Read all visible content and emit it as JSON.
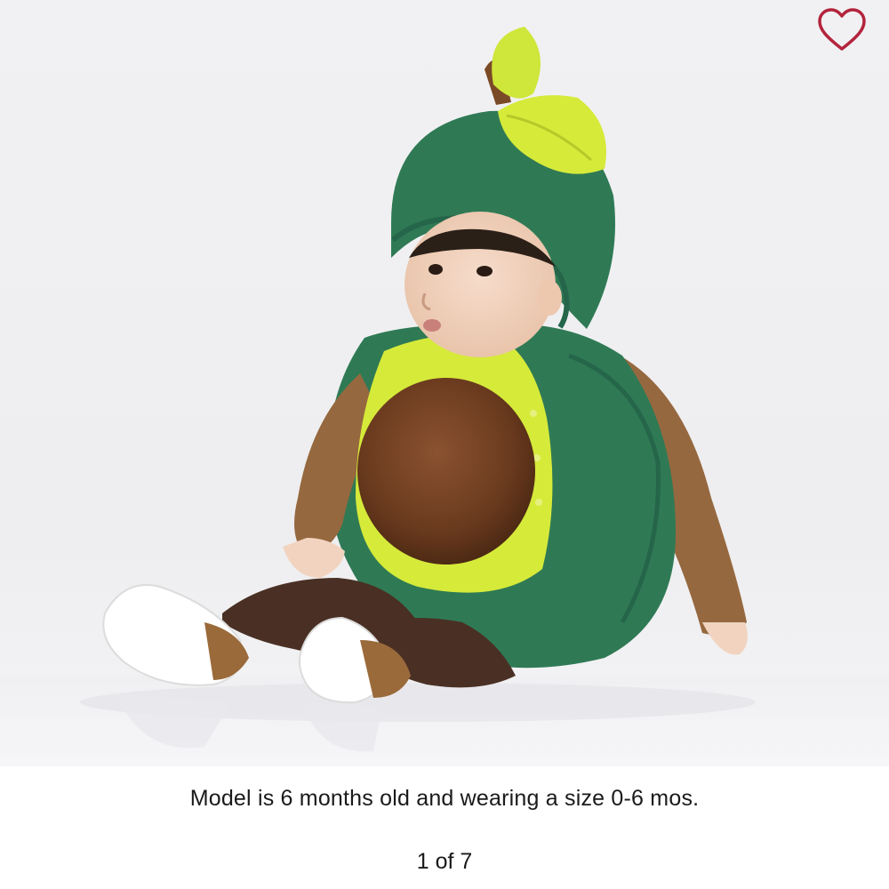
{
  "product_image": {
    "caption": "Model is 6 months old and wearing a size 0-6 mos.",
    "counter": "1 of 7",
    "favorite_icon": "heart-outline-icon",
    "colors": {
      "heart": "#b3243c",
      "costume_green": "#2f7a55",
      "costume_yellow": "#d6ea3a",
      "pit_brown": "#6a3a1e",
      "sleeve_brown": "#96683f",
      "leggings_brown": "#4a3024"
    }
  }
}
